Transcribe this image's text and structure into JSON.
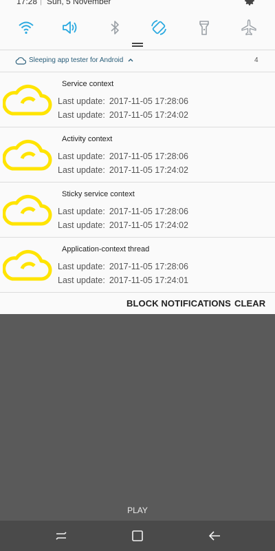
{
  "status_bar": {
    "time": "17:28",
    "separator": "|",
    "date": "Sun, 5 November",
    "settings_icon": "gear-icon"
  },
  "quick_settings": {
    "accent_color": "#2aa9e0",
    "inactive_color": "#9aa0a6",
    "tiles": [
      {
        "icon": "wifi-icon",
        "active": true
      },
      {
        "icon": "sound-icon",
        "active": true
      },
      {
        "icon": "bluetooth-icon",
        "active": false
      },
      {
        "icon": "auto-rotate-icon",
        "active": true
      },
      {
        "icon": "flashlight-icon",
        "active": false
      },
      {
        "icon": "airplane-mode-icon",
        "active": false
      }
    ]
  },
  "app_header": {
    "icon": "cloud-icon",
    "app_name": "Sleeping app tester for Android",
    "expand_icon": "chevron-up-icon",
    "count": "4"
  },
  "notification_icon_color": "#ffe400",
  "notifications": [
    {
      "title": "Service context",
      "rows": [
        {
          "label": "Last update:",
          "value": "2017-11-05 17:28:06"
        },
        {
          "label": "Last update:",
          "value": "2017-11-05 17:24:02"
        }
      ]
    },
    {
      "title": "Activity context",
      "rows": [
        {
          "label": "Last update:",
          "value": "2017-11-05 17:28:06"
        },
        {
          "label": "Last update:",
          "value": "2017-11-05 17:24:02"
        }
      ]
    },
    {
      "title": "Sticky service context",
      "rows": [
        {
          "label": "Last update:",
          "value": "2017-11-05 17:28:06"
        },
        {
          "label": "Last update:",
          "value": "2017-11-05 17:24:02"
        }
      ]
    },
    {
      "title": "Application-context thread",
      "rows": [
        {
          "label": "Last update:",
          "value": "2017-11-05 17:28:06"
        },
        {
          "label": "Last update:",
          "value": "2017-11-05 17:24:01"
        }
      ]
    }
  ],
  "actions": {
    "block_label": "BLOCK NOTIFICATIONS",
    "clear_label": "CLEAR"
  },
  "background": {
    "play_label": "PLAY"
  },
  "navigation": {
    "recents_icon": "recents-icon",
    "home_icon": "home-icon",
    "back_icon": "back-arrow-icon"
  }
}
